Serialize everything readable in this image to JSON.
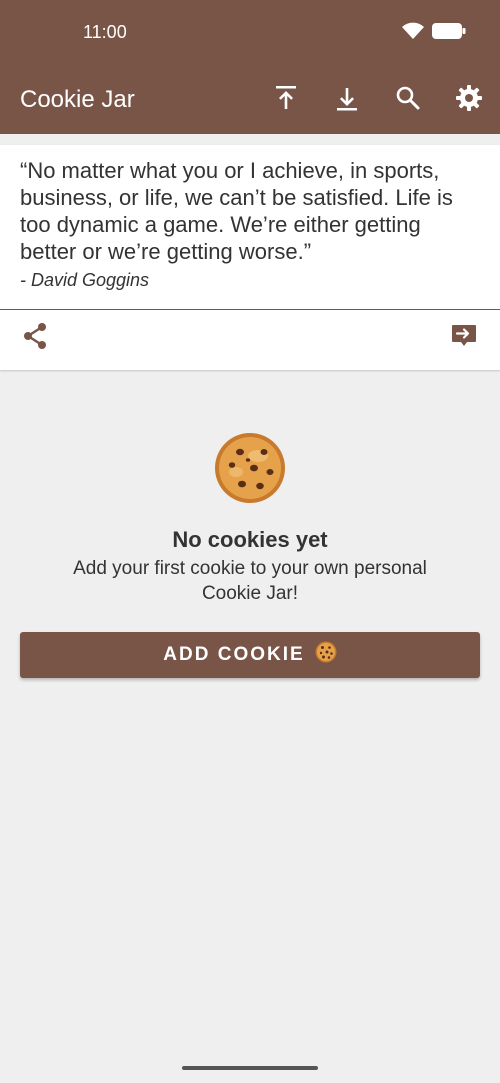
{
  "status_bar": {
    "time": "11:00",
    "icons": [
      "wifi-icon",
      "battery-icon"
    ]
  },
  "app_bar": {
    "title": "Cookie Jar",
    "actions": [
      "upload-icon",
      "download-icon",
      "search-icon",
      "gear-icon"
    ]
  },
  "quote": {
    "text": "“No matter what you or I achieve, in sports, business, or life, we can’t be satisfied. Life is too dynamic a game. We’re either getting better or we’re getting worse.”",
    "author": "- David Goggins",
    "actions": [
      "share-icon",
      "forward-comment-icon"
    ]
  },
  "empty_state": {
    "icon": "cookie-icon",
    "title": "No cookies yet",
    "description": "Add your first cookie to your own personal Cookie Jar!"
  },
  "add_button": {
    "label": "ADD COOKIE",
    "icon": "cookie-icon"
  },
  "colors": {
    "primary": "#795548",
    "background": "#efefef",
    "surface": "#ffffff",
    "text": "#333333"
  }
}
